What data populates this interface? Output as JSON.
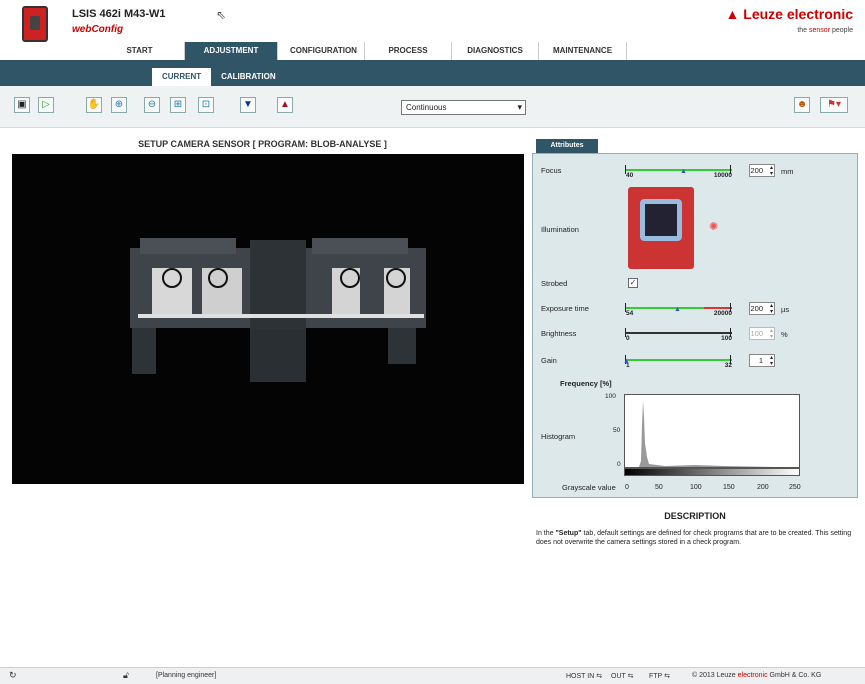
{
  "header": {
    "device": "LSIS 462i M43-W1",
    "app": "webConfig",
    "brand": "Leuze electronic",
    "tagline_pre": "the ",
    "tagline_mid": "sensor",
    "tagline_post": " people"
  },
  "nav": [
    "START",
    "ADJUSTMENT",
    "CONFIGURATION",
    "PROCESS",
    "DIAGNOSTICS",
    "MAINTENANCE"
  ],
  "subnav": [
    "CURRENT",
    "CALIBRATION"
  ],
  "toolbar": {
    "mode": "Continuous"
  },
  "setup_title": "SETUP CAMERA SENSOR   [ PROGRAM: BLOB-ANALYSE ]",
  "attributes": {
    "tab": "Attributes",
    "focus": {
      "label": "Focus",
      "min": "40",
      "max": "10000",
      "value": "200",
      "unit": "mm"
    },
    "illumination": {
      "label": "Illumination"
    },
    "strobed": {
      "label": "Strobed",
      "checked": true
    },
    "exposure": {
      "label": "Exposure time",
      "min": "54",
      "max": "20000",
      "value": "200",
      "unit": "µs"
    },
    "brightness": {
      "label": "Brightness",
      "min": "0",
      "max": "100",
      "value": "100",
      "unit": "%"
    },
    "gain": {
      "label": "Gain",
      "min": "1",
      "max": "32",
      "value": "1"
    },
    "histogram": {
      "label": "Histogram",
      "ylabel": "Frequency [%]",
      "xlabel": "Grayscale value",
      "yticks": [
        "100",
        "50",
        "0"
      ],
      "xticks": [
        "0",
        "50",
        "100",
        "150",
        "200",
        "250"
      ]
    }
  },
  "description": {
    "title": "DESCRIPTION",
    "text_pre": "In the ",
    "text_bold": "\"Setup\"",
    "text_post": " tab, default settings are defined for check programs that are to be created. This setting does not overwrite the camera settings stored in a check program."
  },
  "status": {
    "user": "[Planning engineer]",
    "host": "HOST IN",
    "out": "OUT",
    "ftp": "FTP",
    "copyright_pre": "© 2013 Leuze ",
    "copyright_mid": "electronic",
    "copyright_post": " GmbH & Co. KG"
  },
  "colors": {
    "nav": "#2f5567",
    "brand": "#cc0000"
  }
}
